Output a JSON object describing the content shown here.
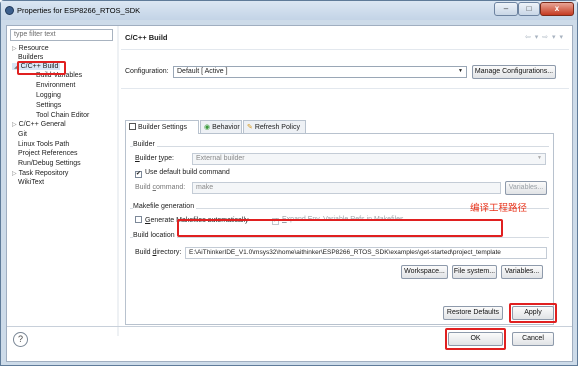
{
  "window": {
    "title": "Properties for ESP8266_RTOS_SDK",
    "controls": {
      "minimize": "–",
      "maximize": "□",
      "close": "x"
    }
  },
  "filter": {
    "placeholder": "type filter text"
  },
  "tree": [
    {
      "label": "Resource",
      "expander": "▷"
    },
    {
      "label": "Builders",
      "expander": ""
    },
    {
      "label": "C/C++ Build",
      "expander": "◢",
      "selected": true
    },
    {
      "label": "Build Variables",
      "expander": ""
    },
    {
      "label": "Environment",
      "expander": ""
    },
    {
      "label": "Logging",
      "expander": ""
    },
    {
      "label": "Settings",
      "expander": ""
    },
    {
      "label": "Tool Chain Editor",
      "expander": ""
    },
    {
      "label": "C/C++ General",
      "expander": "▷"
    },
    {
      "label": "Git",
      "expander": ""
    },
    {
      "label": "Linux Tools Path",
      "expander": ""
    },
    {
      "label": "Project References",
      "expander": ""
    },
    {
      "label": "Run/Debug Settings",
      "expander": ""
    },
    {
      "label": "Task Repository",
      "expander": "▷"
    },
    {
      "label": "WikiText",
      "expander": ""
    }
  ],
  "panel": {
    "title": "C/C++ Build",
    "nav_arrows": "⇦ ▾ ⇨ ▾ ▾",
    "configuration_label": "Configuration:",
    "configuration_value": "Default  [ Active ]",
    "manage_button": "Manage Configurations..."
  },
  "tabs": [
    {
      "label": "Builder Settings",
      "icon": "builder-settings-icon",
      "active": true
    },
    {
      "label": "Behavior",
      "icon": "behavior-icon",
      "active": false
    },
    {
      "label": "Refresh Policy",
      "icon": "refresh-policy-icon",
      "active": false
    }
  ],
  "builder": {
    "group": "Builder",
    "type_label": "Builder type:",
    "type_value": "External builder",
    "use_default_label": "Use default build command",
    "use_default_checked": true,
    "command_label": "Build command:",
    "command_value": "make",
    "variables_button": "Variables..."
  },
  "makefile": {
    "group": "Makefile generation",
    "generate_label": "Generate Makefiles automatically",
    "generate_checked": false,
    "expand_label": "Expand Env. Variable Refs in Makefiles",
    "expand_checked": true
  },
  "location": {
    "group": "Build location",
    "directory_label": "Build directory:",
    "directory_value": "E:\\AiThinkerIDE_V1.0\\msys32\\home\\aithinker\\ESP8266_RTOS_SDK\\examples\\get-started\\project_template",
    "workspace_button": "Workspace...",
    "filesystem_button": "File system...",
    "variables_button": "Variables..."
  },
  "annotation": {
    "text": "编译工程路径",
    "color": "#e8341c"
  },
  "bottom": {
    "restore_button": "Restore Defaults",
    "apply_button": "Apply",
    "ok_button": "OK",
    "cancel_button": "Cancel",
    "help": "?"
  },
  "colors": {
    "highlight": "#e02020",
    "selected_row": "#d8e6f6",
    "titlebar": "#c3d4e6"
  }
}
